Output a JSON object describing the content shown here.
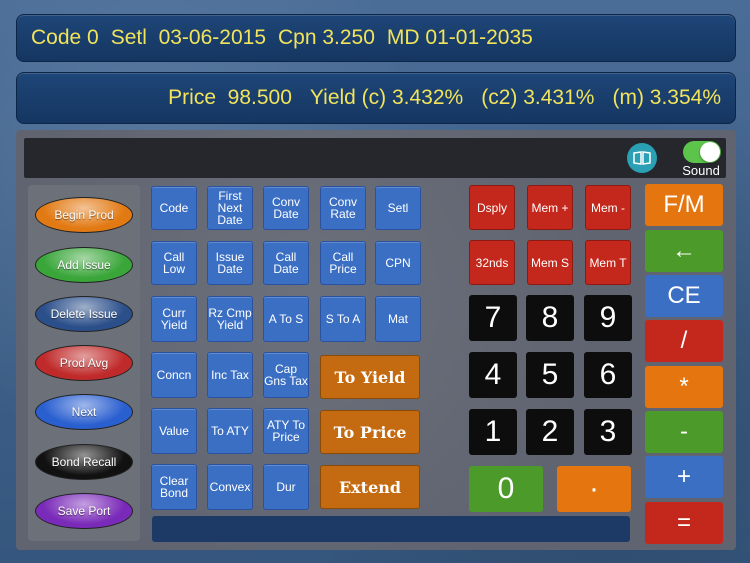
{
  "top": {
    "code": "Code 0",
    "setl": "Setl  03-06-2015",
    "cpn": "Cpn 3.250",
    "md": "MD 01-01-2035"
  },
  "price_line": {
    "price": "Price  98.500",
    "yield_c": "Yield (c) 3.432%",
    "c2": "(c2) 3.431%",
    "m": "(m) 3.354%"
  },
  "toolbar": {
    "sound_label": "Sound",
    "sound_on": true,
    "book_icon": "book-icon"
  },
  "left_buttons": [
    {
      "label": "Begin Prod",
      "color": "#e27a14"
    },
    {
      "label": "Add Issue",
      "color": "#3aa63a"
    },
    {
      "label": "Delete Issue",
      "color": "#2b4f8a"
    },
    {
      "label": "Prod  Avg",
      "color": "#c02a2a"
    },
    {
      "label": "Next",
      "color": "#2a5fd0"
    },
    {
      "label": "Bond Recall",
      "color": "#111111"
    },
    {
      "label": "Save Port",
      "color": "#7a2ab8"
    }
  ],
  "func_grid": [
    [
      "Code",
      "First Next Date",
      "Conv Date",
      "Conv Rate",
      "Setl"
    ],
    [
      "Call Low",
      "Issue Date",
      "Call Date",
      "Call Price",
      "CPN"
    ],
    [
      "Curr Yield",
      "Rz Cmp Yield",
      "A To S",
      "S To A",
      "Mat"
    ],
    [
      "Concn",
      "Inc Tax",
      "Cap Gns Tax"
    ],
    [
      "Value",
      "To ATY",
      "ATY  To Price"
    ],
    [
      "Clear Bond",
      "Convex",
      "Dur"
    ]
  ],
  "big_buttons": [
    "To Yield",
    "To Price",
    "Extend"
  ],
  "red_row1": [
    "Dsply",
    "Mem +",
    "Mem -"
  ],
  "red_row2": [
    "32nds",
    "Mem S",
    "Mem T"
  ],
  "numpad": [
    [
      "7",
      "8",
      "9"
    ],
    [
      "4",
      "5",
      "6"
    ],
    [
      "1",
      "2",
      "3"
    ]
  ],
  "zero": "0",
  "dot": "·",
  "ops": [
    {
      "label": "F/M",
      "color": "#e5760f"
    },
    {
      "label": "←",
      "color": "#4c9a2a"
    },
    {
      "label": "CE",
      "color": "#3a6fc4"
    },
    {
      "label": "/",
      "color": "#c4271b"
    },
    {
      "label": "*",
      "color": "#e5760f"
    },
    {
      "label": "-",
      "color": "#4c9a2a"
    },
    {
      "label": "+",
      "color": "#3a6fc4"
    },
    {
      "label": "=",
      "color": "#c4271b"
    }
  ]
}
